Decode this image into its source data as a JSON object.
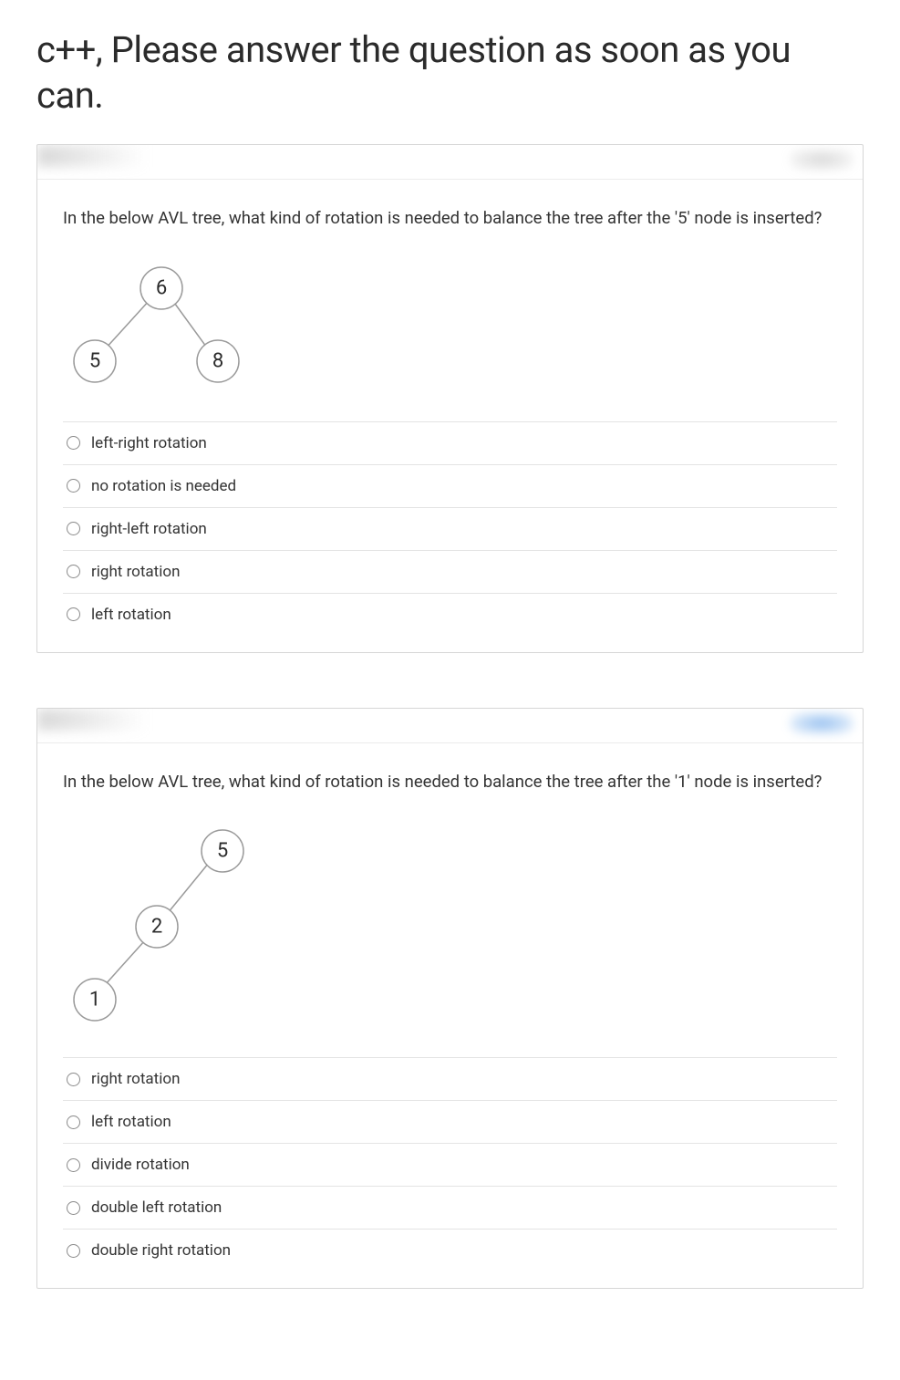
{
  "page_title": "c++, Please answer the question as soon as you can.",
  "questions": [
    {
      "prompt": "In the below AVL tree, what kind of rotation is needed to balance the tree after the '5' node is inserted?",
      "tree": {
        "root": "6",
        "left": "5",
        "right": "8"
      },
      "options": [
        "left-right rotation",
        "no rotation is needed",
        "right-left rotation",
        "right rotation",
        "left rotation"
      ]
    },
    {
      "prompt": "In the below AVL tree, what kind of rotation is needed to balance the tree after the '1' node is inserted?",
      "tree": {
        "root": "5",
        "left": "2",
        "left_left": "1"
      },
      "options": [
        "right rotation",
        "left rotation",
        "divide rotation",
        "double left rotation",
        "double right rotation"
      ]
    }
  ]
}
